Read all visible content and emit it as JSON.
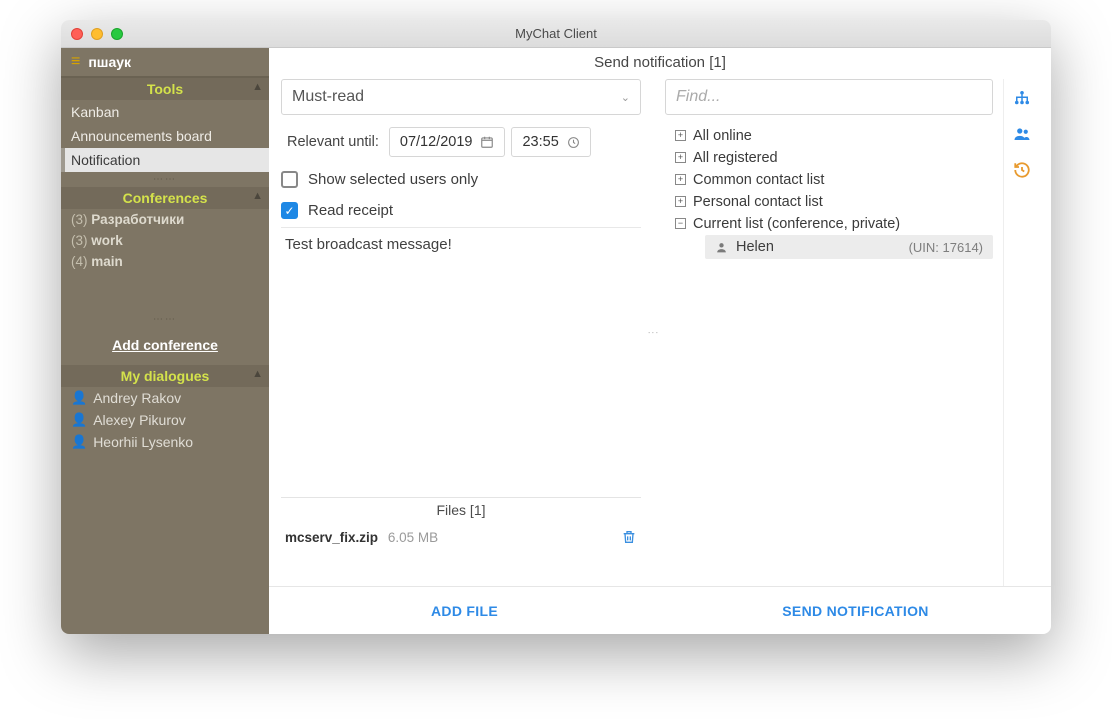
{
  "window": {
    "title": "MyChat Client"
  },
  "sidebar": {
    "username": "пшаук",
    "sections": {
      "tools": {
        "label": "Tools",
        "items": [
          "Kanban",
          "Announcements board",
          "Notification"
        ],
        "active_index": 2
      },
      "conferences": {
        "label": "Conferences",
        "items": [
          {
            "count": "(3)",
            "name": "Разработчики"
          },
          {
            "count": "(3)",
            "name": "work"
          },
          {
            "count": "(4)",
            "name": "main"
          }
        ],
        "add_label": "Add conference"
      },
      "dialogues": {
        "label": "My dialogues",
        "items": [
          "Andrey Rakov",
          "Alexey Pikurov",
          "Heorhii Lysenko"
        ]
      }
    }
  },
  "main": {
    "header": "Send notification [1]",
    "priority_selected": "Must-read",
    "relevant_label": "Relevant until:",
    "date_value": "07/12/2019",
    "time_value": "23:55",
    "chk_show_selected": {
      "label": "Show selected users only",
      "checked": false
    },
    "chk_read_receipt": {
      "label": "Read receipt",
      "checked": true
    },
    "message_text": "Test broadcast message!",
    "files_header": "Files [1]",
    "files": [
      {
        "name": "mcserv_fix.zip",
        "size": "6.05 MB"
      }
    ],
    "footer": {
      "add_file": "ADD FILE",
      "send": "SEND NOTIFICATION"
    }
  },
  "recipients": {
    "find_placeholder": "Find...",
    "groups": [
      {
        "label": "All online",
        "expanded": false
      },
      {
        "label": "All registered",
        "expanded": false
      },
      {
        "label": "Common contact list",
        "expanded": false
      },
      {
        "label": "Personal contact list",
        "expanded": false
      },
      {
        "label": "Current list (conference, private)",
        "expanded": true,
        "children": [
          {
            "name": "Helen",
            "uin": "(UIN: 17614)"
          }
        ]
      }
    ]
  }
}
